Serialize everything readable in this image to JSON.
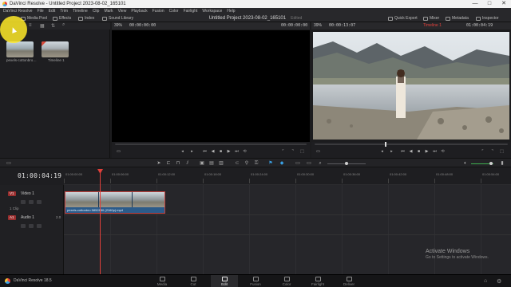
{
  "window": {
    "title": "DaVinci Resolve - Untitled Project 2023-08-02_165101",
    "controls": [
      "—",
      "□",
      "✕"
    ]
  },
  "menu": {
    "items": [
      "DaVinci Resolve",
      "File",
      "Edit",
      "Trim",
      "Timeline",
      "Clip",
      "Mark",
      "View",
      "Playback",
      "Fusion",
      "Color",
      "Fairlight",
      "Workspace",
      "Help"
    ]
  },
  "toolbar": {
    "media_pool": "Media Pool",
    "effects": "Effects",
    "index": "Index",
    "sound_library": "Sound Library",
    "project_title": "Untitled Project 2023-08-02_165101",
    "edited": "Edited",
    "quick_export": "Quick Export",
    "mixer": "Mixer",
    "metadata": "Metadata",
    "inspector": "Inspector"
  },
  "media_pool": {
    "clips": [
      {
        "name": "pexels-cottonbro…"
      },
      {
        "name": "Timeline 1"
      }
    ]
  },
  "source_viewer": {
    "zoom": "39%",
    "timecode_left": "00:00:00:00",
    "timecode_right": "00:00:00:00"
  },
  "timeline_viewer": {
    "zoom": "39%",
    "timecode_left": "00:00:13:07",
    "timeline_name": "Timeline 1",
    "timecode_right": "01:00:04:19"
  },
  "timeline": {
    "current_timecode": "01:00:04:19",
    "ruler_labels": [
      "01:00:00:00",
      "01:00:06:00",
      "01:00:12:00",
      "01:00:18:00",
      "01:00:24:00",
      "01:00:30:00",
      "01:00:36:00",
      "01:00:42:00",
      "01:00:48:00",
      "01:00:54:00"
    ],
    "tracks": {
      "video1": {
        "badge": "V1",
        "name": "Video 1",
        "count": "1 Clip"
      },
      "audio1": {
        "badge": "A1",
        "name": "Audio 1",
        "level": "2.0"
      }
    },
    "clip_label": "pexels-cottonbro 5852850 (2160p).mp4"
  },
  "pages": {
    "app_name": "DaVinci Resolve 18.5",
    "tabs": [
      "Media",
      "Cut",
      "Edit",
      "Fusion",
      "Color",
      "Fairlight",
      "Deliver"
    ],
    "active": "Edit"
  },
  "watermark": {
    "line1": "Activate Windows",
    "line2": "Go to Settings to activate Windows."
  },
  "colors": {
    "accent_red": "#e0403a",
    "clip_blue": "#2b5b8a",
    "v1_badge": "#9b2f2f",
    "a1_badge": "#9b2f2f"
  }
}
